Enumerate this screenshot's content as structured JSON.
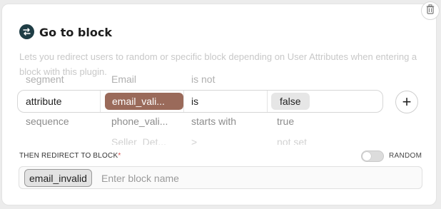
{
  "header": {
    "title": "Go to block",
    "description": "Lets you redirect users to random or specific block depending on User Attributes when entering a block with this plugin."
  },
  "rule_picker": {
    "row_above": {
      "type": "segment",
      "attribute": "Email",
      "operator": "is not"
    },
    "selected_row": {
      "type": "attribute",
      "attribute": "email_vali...",
      "operator": "is",
      "value": "false"
    },
    "row_below": {
      "type": "sequence",
      "attribute": "phone_vali...",
      "operator": "starts with",
      "value": "true"
    },
    "row_faded": {
      "attribute": "Seller_Det...",
      "operator": ">",
      "value": "not set"
    }
  },
  "redirect": {
    "label": "THEN REDIRECT TO BLOCK",
    "required_mark": "*",
    "random_label": "RANDOM",
    "random_enabled": false,
    "selected_block": "email_invalid",
    "placeholder": "Enter block name"
  },
  "icons": {
    "header": "redirect-arrows-icon",
    "delete": "trash-icon",
    "add": "plus-icon"
  },
  "colors": {
    "header_icon_bg": "#1f3d45",
    "attribute_chip": "#9a6a5a",
    "required_mark": "#d9534f"
  }
}
